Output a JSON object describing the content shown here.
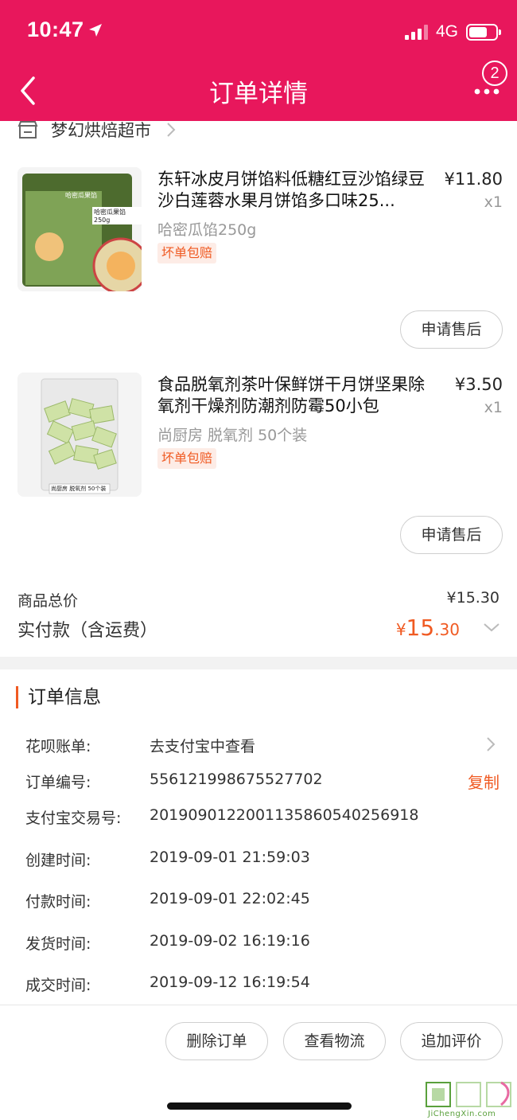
{
  "status_bar": {
    "time": "10:47",
    "network": "4G"
  },
  "nav": {
    "title": "订单详情",
    "badge_count": "2"
  },
  "shop": {
    "name": "梦幻烘焙超市"
  },
  "items": [
    {
      "title": "东轩冰皮月饼馅料低糖红豆沙馅绿豆沙白莲蓉水果月饼馅多口味25...",
      "price": "¥11.80",
      "qty": "x1",
      "sku": "哈密瓜馅250g",
      "tag": "坏单包赔",
      "action": "申请售后",
      "image": {
        "brand_text": "哈密瓜果馅",
        "label": "哈密瓜果馅250g"
      }
    },
    {
      "title": "食品脱氧剂茶叶保鲜饼干月饼坚果除氧剂干燥剂防潮剂防霉50小包",
      "price": "¥3.50",
      "qty": "x1",
      "sku": "尚厨房 脱氧剂 50个装",
      "tag": "坏单包赔",
      "action": "申请售后",
      "image": {
        "label": "尚厨房 脱氧剂 50个装"
      }
    }
  ],
  "summary": {
    "total_label": "商品总价",
    "total_value": "¥15.30",
    "pay_label": "实付款（含运费）",
    "pay_currency": "¥",
    "pay_int": "15",
    "pay_dec": ".30"
  },
  "order_info": {
    "title": "订单信息",
    "rows": [
      {
        "label": "花呗账单:",
        "value": "去支付宝中查看"
      },
      {
        "label": "订单编号:",
        "value": "556121998675527702"
      },
      {
        "label": "支付宝交易号:",
        "value": "2019090122001135860540256918"
      },
      {
        "label": "创建时间:",
        "value": "2019-09-01 21:59:03"
      },
      {
        "label": "付款时间:",
        "value": "2019-09-01 22:02:45"
      },
      {
        "label": "发货时间:",
        "value": "2019-09-02 16:19:16"
      },
      {
        "label": "成交时间:",
        "value": "2019-09-12 16:19:54"
      }
    ],
    "copy_label": "复制"
  },
  "footer": {
    "buttons": [
      "删除订单",
      "查看物流",
      "追加评价"
    ]
  },
  "watermark": {
    "text": "JiChengXin.com"
  },
  "colors": {
    "header": "#e8175c",
    "accent": "#f05a22"
  }
}
